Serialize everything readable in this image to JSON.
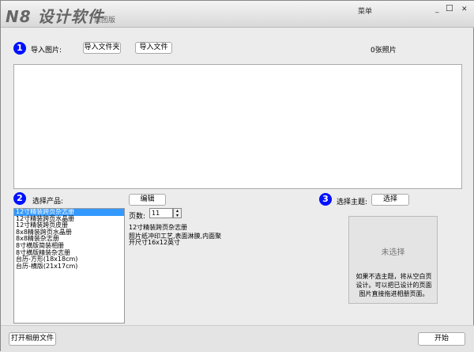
{
  "title": {
    "logo": "N8 设计软件",
    "edition": "集团版",
    "menu": "菜单",
    "minimize": "_",
    "maximize": "☐",
    "close": "✕"
  },
  "step1": {
    "num": "1",
    "label": "导入图片:",
    "import_folder": "导入文件夹",
    "import_file": "导入文件",
    "photo_count": "0张照片"
  },
  "step2": {
    "num": "2",
    "label": "选择产品:",
    "edit": "编辑",
    "pages_label": "页数:",
    "pages_value": "11",
    "products": [
      "12寸精装跨页杂志册",
      "12寸精装跨页水晶册",
      "12寸精装跨页皮册",
      "8x8精装跨页水晶册",
      "8x8精装杂志册",
      "8寸横版简装相册",
      "8寸横版精装杂志册",
      "台历-方形(18x18cm)",
      "台历-横版(21x17cm)"
    ],
    "selected_index": 0,
    "desc_title": "12寸精装跨页杂志册",
    "desc_line1": "照片纸冲印工艺,表面淋膜,内面聚",
    "desc_line2": "开尺寸16x12英寸"
  },
  "step3": {
    "num": "3",
    "label": "选择主题:",
    "choose": "选择",
    "none_selected": "未选择",
    "hint": "如果不选主题，将从空白页设计。可以把已设计的页面图片直接拖进相册页面。"
  },
  "bottom": {
    "open": "打开相册文件",
    "start": "开始"
  }
}
